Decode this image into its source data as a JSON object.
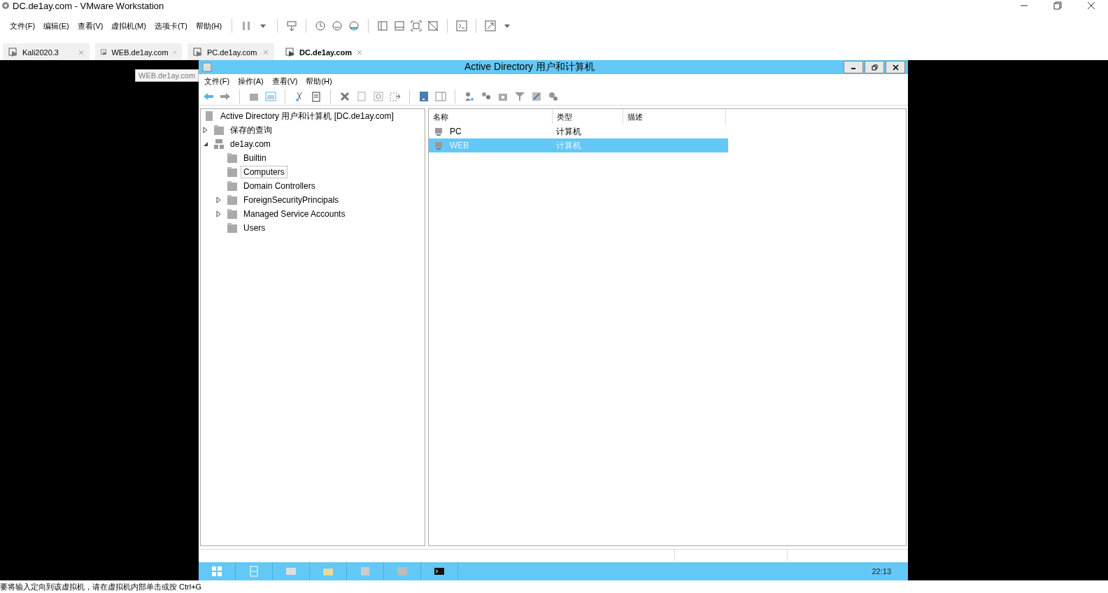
{
  "window": {
    "title": "DC.de1ay.com - VMware Workstation"
  },
  "menu": [
    "文件(F)",
    "编辑(E)",
    "查看(V)",
    "虚拟机(M)",
    "选项卡(T)",
    "帮助(H)"
  ],
  "tabs": [
    {
      "label": "Kali2020.3",
      "selected": false
    },
    {
      "label": "WEB.de1ay.com",
      "selected": false
    },
    {
      "label": "PC.de1ay.com",
      "selected": false
    },
    {
      "label": "DC.de1ay.com",
      "selected": true
    }
  ],
  "tooltip": "WEB.de1ay.com",
  "guest": {
    "title": "Active Directory 用户和计算机",
    "menu": [
      "文件(F)",
      "操作(A)",
      "查看(V)",
      "帮助(H)"
    ],
    "tree": {
      "label": "Active Directory 用户和计算机 [DC.de1ay.com]",
      "children": [
        {
          "label": "保存的查询",
          "expanded": false,
          "selected": false
        },
        {
          "label": "de1ay.com",
          "expanded": true,
          "selected": false,
          "kind": "domain",
          "children": [
            {
              "label": "Builtin",
              "selected": false
            },
            {
              "label": "Computers",
              "selected": true
            },
            {
              "label": "Domain Controllers",
              "selected": false
            },
            {
              "label": "ForeignSecurityPrincipals",
              "expanded": false,
              "selected": false
            },
            {
              "label": "Managed Service Accounts",
              "expanded": false,
              "selected": false
            },
            {
              "label": "Users",
              "selected": false
            }
          ]
        }
      ]
    },
    "columns": [
      "名称",
      "类型",
      "描述"
    ],
    "rows": [
      {
        "name": "PC",
        "type": "计算机",
        "selected": false
      },
      {
        "name": "WEB",
        "type": "计算机",
        "selected": true
      }
    ],
    "clock": "22:13"
  },
  "status_bar": "要将输入定向到该虚拟机，请在虚拟机内部单击或按 Ctrl+G"
}
